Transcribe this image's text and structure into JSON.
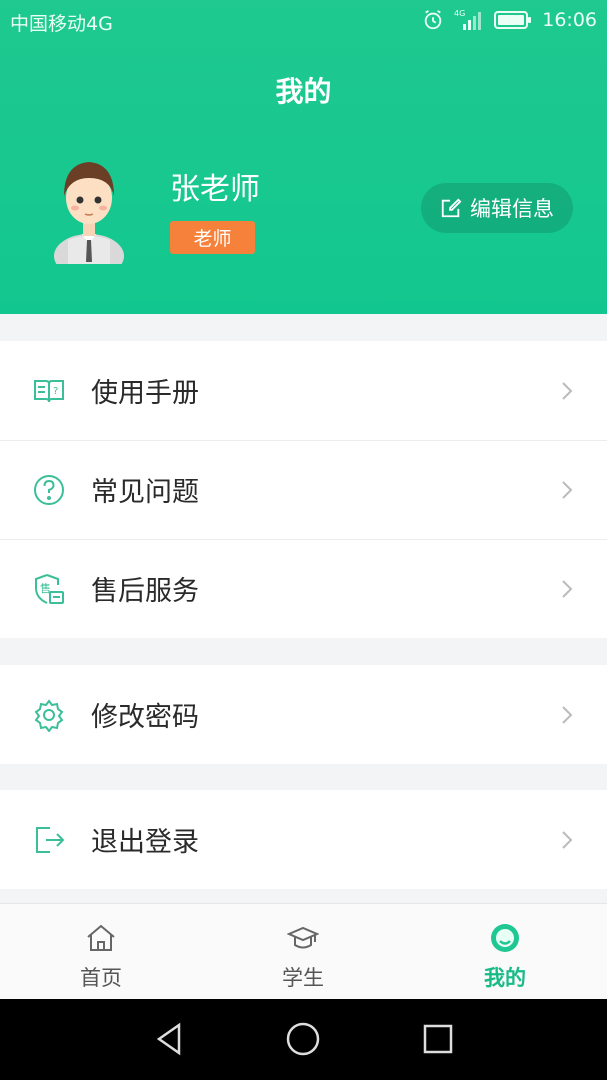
{
  "status_bar": {
    "carrier": "中国移动4G",
    "network": "4G",
    "time": "16:06"
  },
  "header": {
    "title": "我的"
  },
  "profile": {
    "name": "张老师",
    "role": "老师",
    "edit_label": "编辑信息"
  },
  "menu_group_1": [
    {
      "label": "使用手册",
      "icon": "manual-book-icon"
    },
    {
      "label": "常见问题",
      "icon": "question-circle-icon"
    },
    {
      "label": "售后服务",
      "icon": "after-sales-shield-icon"
    }
  ],
  "menu_group_2": [
    {
      "label": "修改密码",
      "icon": "gear-icon"
    }
  ],
  "menu_group_3": [
    {
      "label": "退出登录",
      "icon": "logout-icon"
    }
  ],
  "bottom_nav": [
    {
      "label": "首页",
      "icon": "home-icon",
      "active": false
    },
    {
      "label": "学生",
      "icon": "graduation-cap-icon",
      "active": false
    },
    {
      "label": "我的",
      "icon": "profile-active-icon",
      "active": true
    }
  ],
  "colors": {
    "accent": "#18c58c",
    "badge": "#f6813b",
    "icon": "#3cbf99"
  }
}
